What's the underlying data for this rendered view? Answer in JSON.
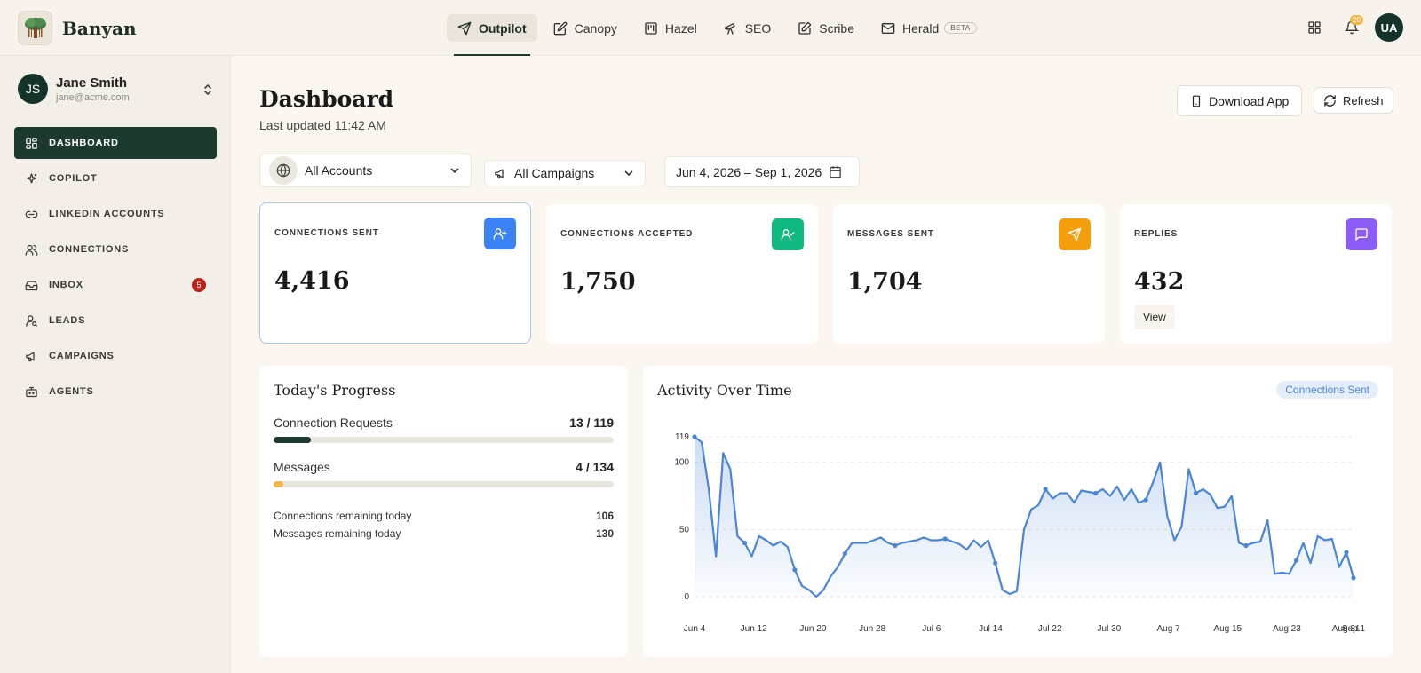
{
  "brand": {
    "name": "Banyan"
  },
  "nav": [
    {
      "label": "Outpilot",
      "icon": "send-icon",
      "active": true
    },
    {
      "label": "Canopy",
      "icon": "edit-icon"
    },
    {
      "label": "Hazel",
      "icon": "board-icon"
    },
    {
      "label": "SEO",
      "icon": "telescope-icon"
    },
    {
      "label": "Scribe",
      "icon": "pen-square-icon"
    },
    {
      "label": "Herald",
      "icon": "mail-icon",
      "badge": "BETA"
    }
  ],
  "topbar": {
    "notification_count": "20",
    "user_initials": "UA"
  },
  "profile": {
    "initials": "JS",
    "name": "Jane Smith",
    "email": "jane@acme.com"
  },
  "sidebar": {
    "items": [
      {
        "label": "DASHBOARD",
        "icon": "grid-icon",
        "active": true
      },
      {
        "label": "COPILOT",
        "icon": "sparkles-icon"
      },
      {
        "label": "LINKEDIN ACCOUNTS",
        "icon": "link-icon"
      },
      {
        "label": "CONNECTIONS",
        "icon": "users-icon"
      },
      {
        "label": "INBOX",
        "icon": "inbox-icon",
        "badge": "5"
      },
      {
        "label": "LEADS",
        "icon": "user-search-icon"
      },
      {
        "label": "CAMPAIGNS",
        "icon": "megaphone-icon"
      },
      {
        "label": "AGENTS",
        "icon": "bot-icon"
      }
    ]
  },
  "header": {
    "title": "Dashboard",
    "subtitle": "Last updated 11:42 AM",
    "download_label": "Download App",
    "refresh_label": "Refresh"
  },
  "filters": {
    "accounts": "All Accounts",
    "campaigns": "All Campaigns",
    "date_range": "Jun 4, 2026 – Sep 1, 2026"
  },
  "stats": [
    {
      "label": "CONNECTIONS SENT",
      "value": "4,416",
      "color": "#3b82f6",
      "icon": "user-plus-icon"
    },
    {
      "label": "CONNECTIONS ACCEPTED",
      "value": "1,750",
      "color": "#10b981",
      "icon": "user-check-icon"
    },
    {
      "label": "MESSAGES SENT",
      "value": "1,704",
      "color": "#f59e0b",
      "icon": "send-icon"
    },
    {
      "label": "REPLIES",
      "value": "432",
      "color": "#8b5cf6",
      "icon": "message-icon",
      "action": "View"
    }
  ],
  "progress": {
    "title": "Today's Progress",
    "rows": [
      {
        "label": "Connection Requests",
        "value": "13 / 119",
        "fraction": 0.109,
        "color": "#1c3a2e"
      },
      {
        "label": "Messages",
        "value": "4 / 134",
        "fraction": 0.03,
        "color": "#f2b54a"
      }
    ],
    "remaining": [
      {
        "label": "Connections remaining today",
        "value": "106"
      },
      {
        "label": "Messages remaining today",
        "value": "130"
      }
    ]
  },
  "activity": {
    "title": "Activity Over Time",
    "legend_label": "Connections Sent"
  },
  "chart_data": {
    "type": "area",
    "series": [
      {
        "name": "Connections Sent",
        "color": "#4a86d8",
        "values": [
          119,
          115,
          80,
          30,
          107,
          95,
          45,
          40,
          30,
          45,
          42,
          38,
          41,
          37,
          20,
          8,
          5,
          0,
          5,
          15,
          22,
          32,
          40,
          40,
          40,
          42,
          44,
          40,
          38,
          40,
          41,
          42,
          44,
          42,
          42,
          43,
          41,
          39,
          35,
          42,
          37,
          42,
          25,
          5,
          2,
          4,
          50,
          65,
          68,
          80,
          73,
          77,
          77,
          70,
          79,
          78,
          77,
          80,
          75,
          82,
          72,
          80,
          70,
          72,
          85,
          100,
          60,
          42,
          52,
          95,
          77,
          80,
          76,
          66,
          67,
          75,
          40,
          38,
          40,
          41,
          57,
          17,
          18,
          17,
          27,
          40,
          25,
          45,
          42,
          43,
          22,
          33,
          14
        ]
      }
    ],
    "x_tick_labels": [
      "Jun 4",
      "Jun 12",
      "Jun 20",
      "Jun 28",
      "Jul 6",
      "Jul 14",
      "Jul 22",
      "Jul 30",
      "Aug 7",
      "Aug 15",
      "Aug 23",
      "Aug 31",
      "Sep 1"
    ],
    "y_ticks": [
      0,
      50,
      100,
      119
    ],
    "ylim": [
      0,
      119
    ],
    "grid": true
  }
}
